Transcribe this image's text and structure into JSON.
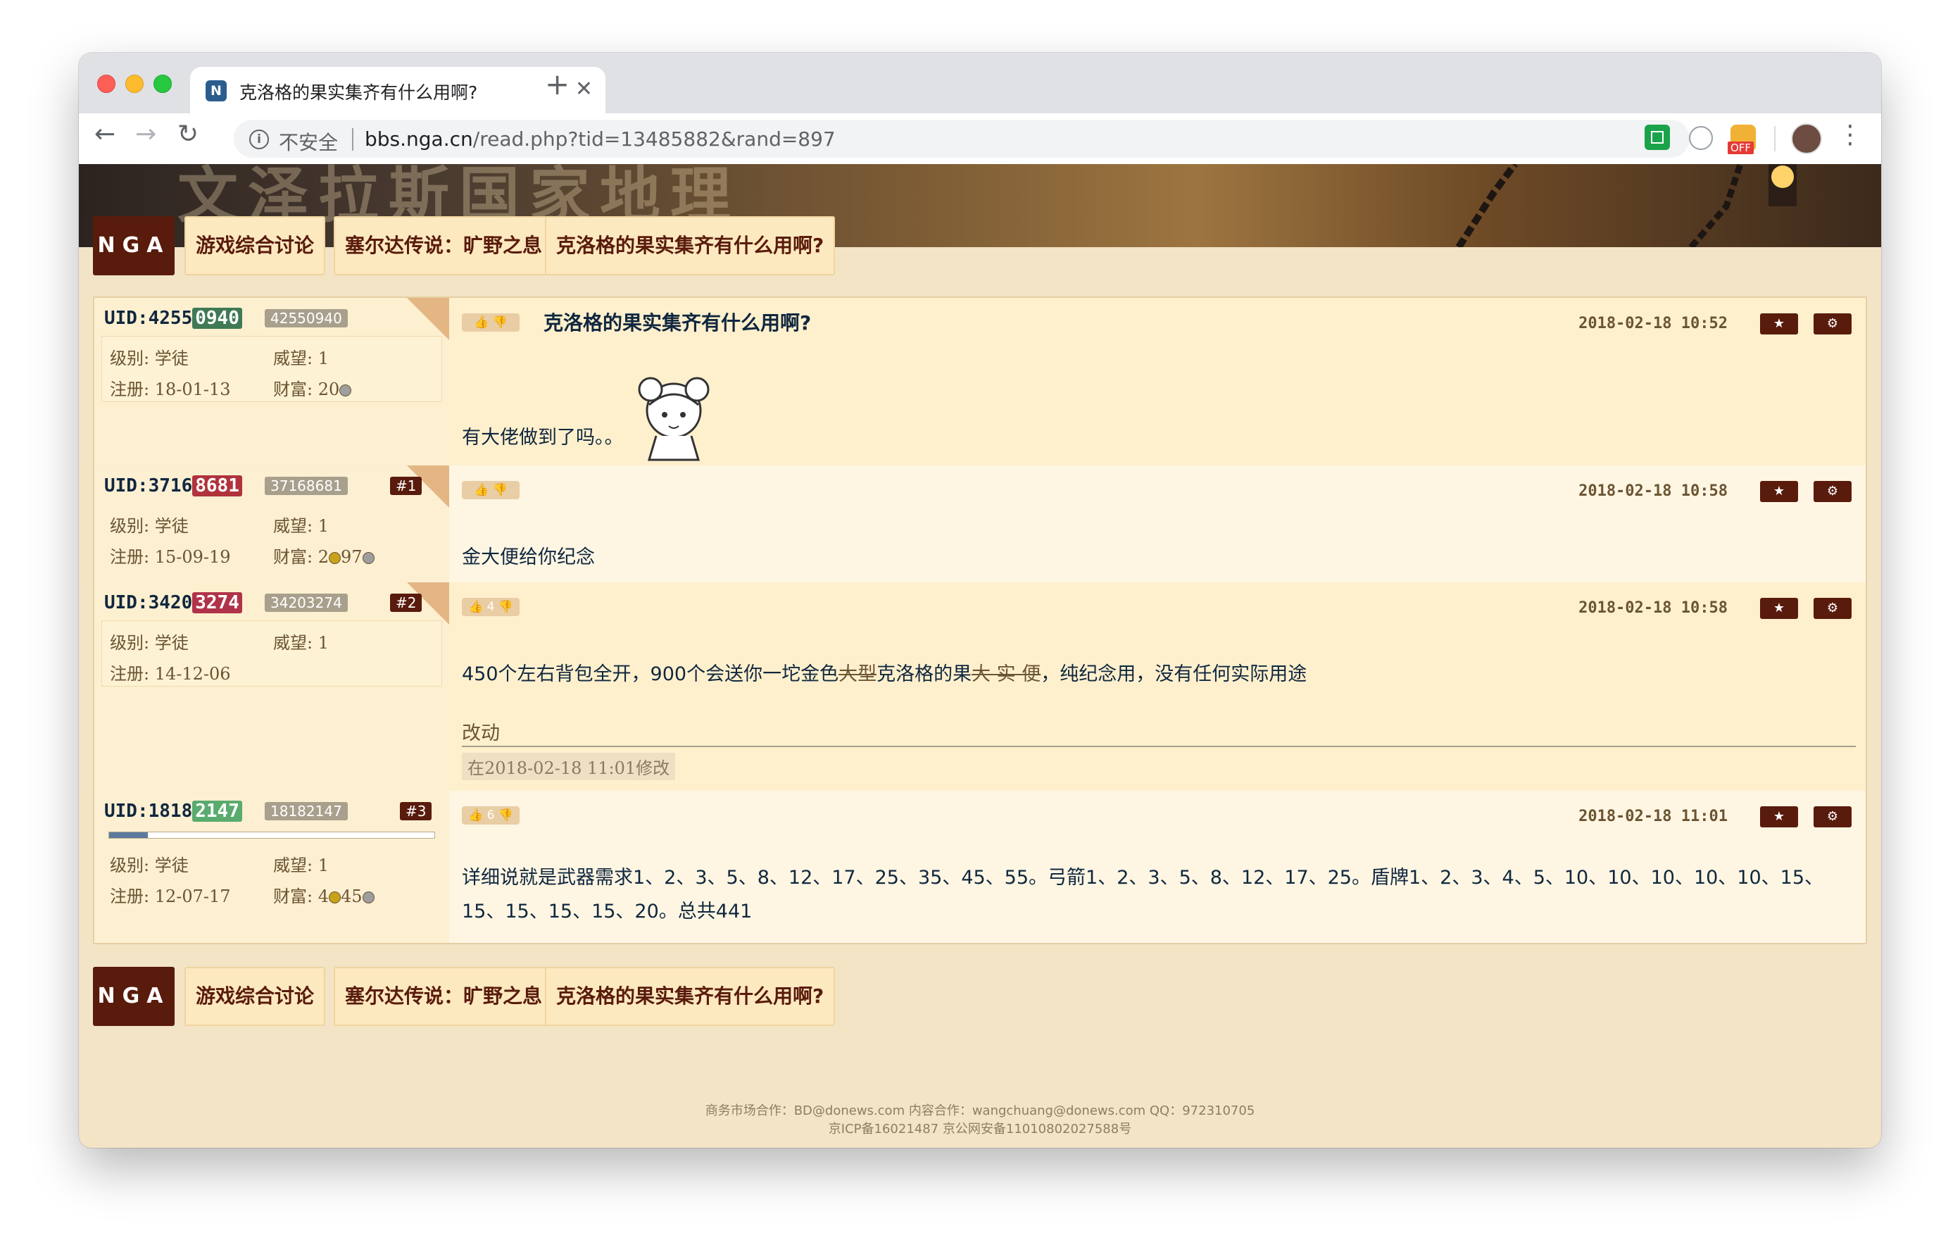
{
  "browser": {
    "tab_title": "克洛格的果实集齐有什么用啊?",
    "security_label": "不安全",
    "url_host": "bbs.nga.cn",
    "url_path": "/read.php?tid=13485882&rand=897",
    "extension_badge": "OFF"
  },
  "breadcrumb": {
    "logo": "NGA",
    "items": [
      "游戏综合讨论",
      "塞尔达传说：旷野之息",
      "克洛格的果实集齐有什么用啊?"
    ]
  },
  "labels": {
    "level": "级别: ",
    "prestige": "威望: ",
    "registered": "注册: ",
    "wealth": "财富: "
  },
  "posts": [
    {
      "uid_prefix": "UID:4255",
      "uid_suffix": "0940",
      "uid_color": "#3f7a55",
      "uid_raw": "42550940",
      "floor": "",
      "level": "学徒",
      "prestige": "1",
      "registered": "18-01-13",
      "wealth": "20",
      "votes": "",
      "title": "克洛格的果实集齐有什么用啊?",
      "date": "2018-02-18 10:52",
      "text": "有大佬做到了吗。。"
    },
    {
      "uid_prefix": "UID:3716",
      "uid_suffix": "8681",
      "uid_color": "#b0333c",
      "uid_raw": "37168681",
      "floor": "#1",
      "level": "学徒",
      "prestige": "1",
      "registered": "15-09-19",
      "wealth_a": "2",
      "wealth_b": "97",
      "votes": "",
      "date": "2018-02-18 10:58",
      "text": "金大便给你纪念"
    },
    {
      "uid_prefix": "UID:3420",
      "uid_suffix": "3274",
      "uid_color": "#b0334a",
      "uid_raw": "34203274",
      "floor": "#2",
      "level": "学徒",
      "prestige": "1",
      "registered": "14-12-06",
      "votes": "4",
      "date": "2018-02-18 10:58",
      "text_a": "450个左右背包全开，900个会送你一坨金色",
      "text_strike_a": "大型",
      "text_b": "克洛格的果",
      "text_strike_b": "大 实 便",
      "text_c": "，纯纪念用，没有任何实际用途",
      "edit_label": "改动",
      "edit_note": "在2018-02-18 11:01修改"
    },
    {
      "uid_prefix": "UID:1818",
      "uid_suffix": "2147",
      "uid_color": "#5aab6e",
      "uid_raw": "18182147",
      "floor": "#3",
      "progress": 0.12,
      "level": "学徒",
      "prestige": "1",
      "registered": "12-07-17",
      "wealth_a": "4",
      "wealth_b": "45",
      "votes": "6",
      "date": "2018-02-18 11:01",
      "text": "详细说就是武器需求1、2、3、5、8、12、17、25、35、45、55。弓箭1、2、3、5、8、12、17、25。盾牌1、2、3、4、5、10、10、10、10、10、15、15、15、15、15、20。总共441"
    }
  ],
  "footer": {
    "line1": "商务市场合作：BD@donews.com 内容合作：wangchuang@donews.com QQ：972310705",
    "line2": "京ICP备16021487 京公网安备110108020275​88号"
  }
}
